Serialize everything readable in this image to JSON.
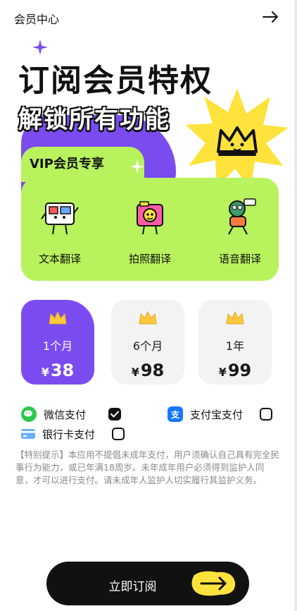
{
  "header": {
    "title": "会员中心",
    "back_icon": "arrow-right-icon"
  },
  "hero": {
    "headline": "订阅会员特权",
    "subline": "解锁所有功能",
    "colors": {
      "purple": "#7a4cf0",
      "lime": "#b8f25c",
      "yellow": "#ffe23b"
    }
  },
  "vip": {
    "title": "VIP会员专享",
    "features": [
      {
        "label": "文本翻译",
        "icon": "text-translate-character-icon"
      },
      {
        "label": "拍照翻译",
        "icon": "photo-translate-character-icon"
      },
      {
        "label": "语音翻译",
        "icon": "voice-translate-character-icon"
      }
    ]
  },
  "plans": [
    {
      "duration": "1个月",
      "currency": "¥",
      "price": "38",
      "selected": true
    },
    {
      "duration": "6个月",
      "currency": "¥",
      "price": "98",
      "selected": false
    },
    {
      "duration": "1年",
      "currency": "¥",
      "price": "99",
      "selected": false
    }
  ],
  "payment": {
    "options": [
      {
        "label": "微信支付",
        "icon": "wechat-pay-icon",
        "checked": true
      },
      {
        "label": "支付宝支付",
        "icon": "alipay-icon",
        "checked": false
      },
      {
        "label": "银行卡支付",
        "icon": "bank-card-icon",
        "checked": false
      }
    ]
  },
  "notice": "【特别提示】本应用不提倡未成年支付，用户须确认自己具有完全民事行为能力，或已年满18周岁。未年成年用户必须得到监护人同意，才可以进行支付。请未成年人监护人切实履行其监护义务。",
  "cta": {
    "label": "立即订阅",
    "icon": "arrow-right-icon"
  }
}
